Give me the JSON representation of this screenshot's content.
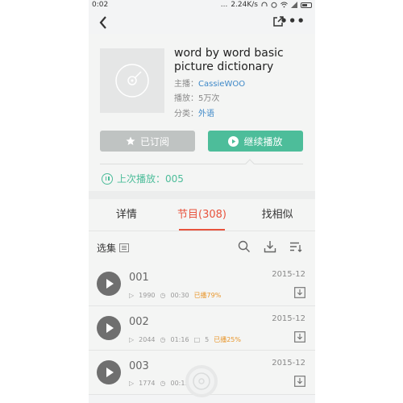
{
  "status_bar": {
    "time": "0:02",
    "dots": "...",
    "speed": "2.24K/s"
  },
  "nav": {
    "back_icon": "chevron-left-icon",
    "share_icon": "share-icon",
    "more_label": "•••"
  },
  "album": {
    "title": "word by word basic picture dictionary",
    "host_label": "主播：",
    "host": "CassieWOO",
    "plays_label": "播放：",
    "plays": "5万次",
    "category_label": "分类：",
    "category": "外语"
  },
  "actions": {
    "subscribed": "已订阅",
    "continue": "继续播放"
  },
  "last_play": {
    "text": "上次播放：005"
  },
  "tabs": [
    {
      "label": "详情",
      "active": false
    },
    {
      "label": "节目(308)",
      "active": true
    },
    {
      "label": "找相似",
      "active": false
    }
  ],
  "toolbar": {
    "select_label": "选集"
  },
  "episodes": [
    {
      "number": "001",
      "date": "2015-12",
      "plays": "1990",
      "duration": "00:30",
      "comments": "",
      "played": "已播79%"
    },
    {
      "number": "002",
      "date": "2015-12",
      "plays": "2044",
      "duration": "01:16",
      "comments": "5",
      "played": "已播25%"
    },
    {
      "number": "003",
      "date": "2015-12",
      "plays": "1774",
      "duration": "00:15",
      "comments": "",
      "played": ""
    }
  ],
  "colors": {
    "accent_green": "#4dbd9a",
    "accent_red": "#e8533d",
    "played_orange": "#e8962b",
    "link_blue": "#3d88c8"
  }
}
